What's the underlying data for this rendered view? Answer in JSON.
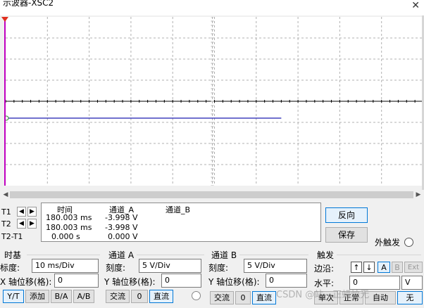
{
  "window": {
    "title": "示波器-XSC2",
    "close_glyph": "✕"
  },
  "screen": {
    "background": "#ffffff",
    "grid_color": "#b0b0b0",
    "axis_color": "#000000",
    "trace_color": "#1a1ab0",
    "cursor_color": "#c000c0"
  },
  "cursors": {
    "t1_label": "T1",
    "t2_label": "T2",
    "diff_label": "T2-T1",
    "left_glyph": "◀",
    "right_glyph": "▶"
  },
  "measurement": {
    "headers": {
      "time": "时间",
      "chA": "通道_A",
      "chB": "通道_B"
    },
    "rows": [
      {
        "time": "180.003 ms",
        "chA": "-3.998 V",
        "chB": ""
      },
      {
        "time": "180.003 ms",
        "chA": "-3.998 V",
        "chB": ""
      },
      {
        "time": "0.000 s",
        "chA": "0.000 V",
        "chB": ""
      }
    ]
  },
  "actions": {
    "reverse": "反向",
    "save": "保存",
    "ext_trigger": "外触发"
  },
  "timebase": {
    "group": "时基",
    "scale_label": "标度:",
    "scale_value": "10 ms/Div",
    "xpos_label": "X 轴位移(格):",
    "xpos_value": "0",
    "buttons": [
      "Y/T",
      "添加",
      "B/A",
      "A/B"
    ]
  },
  "channel_a": {
    "group": "通道 A",
    "scale_label": "刻度:",
    "scale_value": "5  V/Div",
    "ypos_label": "Y 轴位移(格):",
    "ypos_value": "0",
    "coupling": [
      "交流",
      "0",
      "直流"
    ]
  },
  "channel_b": {
    "group": "通道 B",
    "scale_label": "刻度:",
    "scale_value": "5  V/Div",
    "ypos_label": "Y 轴位移(格):",
    "ypos_value": "0",
    "coupling": [
      "交流",
      "0",
      "直流"
    ]
  },
  "trigger": {
    "group": "触发",
    "edge_label": "边沿:",
    "edge_buttons": [
      "↑",
      "↓",
      "A",
      "B",
      "Ext"
    ],
    "level_label": "水平:",
    "level_value": "0",
    "level_unit": "V",
    "mode_buttons": [
      "单次",
      "正常",
      "自动",
      "无"
    ]
  },
  "watermark": "CSDN @站—正蜡烛无"
}
